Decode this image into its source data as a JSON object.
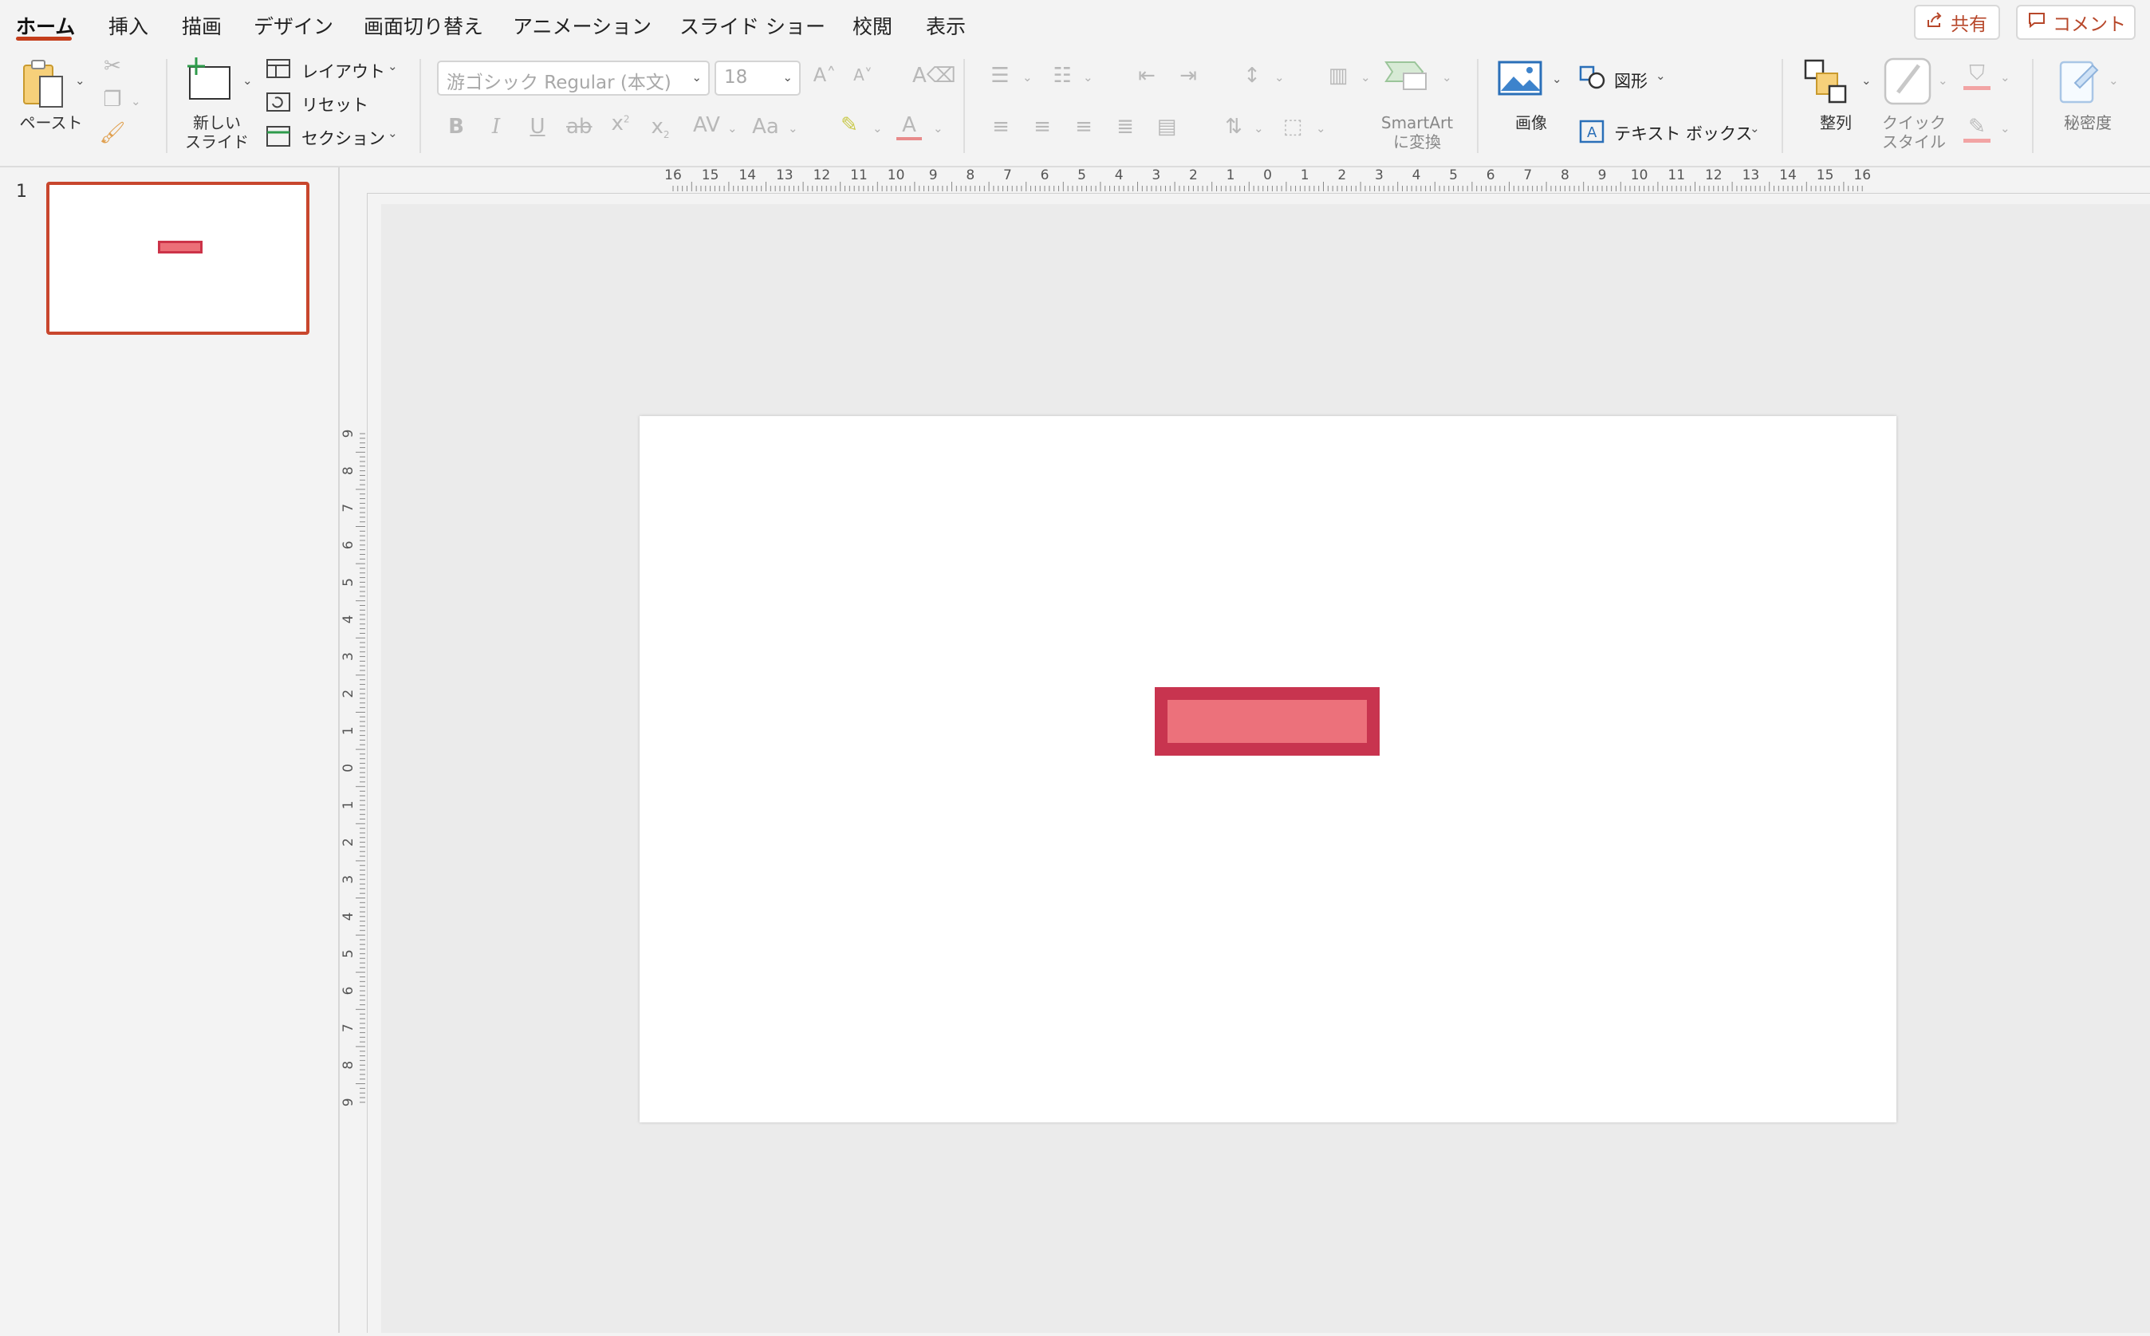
{
  "menu": {
    "tabs": [
      {
        "label": "ホーム",
        "active": true
      },
      {
        "label": "挿入"
      },
      {
        "label": "描画"
      },
      {
        "label": "デザイン"
      },
      {
        "label": "画面切り替え"
      },
      {
        "label": "アニメーション"
      },
      {
        "label": "スライド ショー"
      },
      {
        "label": "校閲"
      },
      {
        "label": "表示"
      }
    ],
    "share_label": "共有",
    "comment_label": "コメント"
  },
  "ribbon": {
    "paste_label": "ペースト",
    "new_slide_label_1": "新しい",
    "new_slide_label_2": "スライド",
    "layout_label": "レイアウト",
    "reset_label": "リセット",
    "section_label": "セクション",
    "font_name": "游ゴシック Regular (本文)",
    "font_size": "18",
    "smartart_label_1": "SmartArt",
    "smartart_label_2": "に変換",
    "image_label": "画像",
    "shapes_label": "図形",
    "textbox_label": "テキスト ボックス",
    "arrange_label": "整列",
    "quick_style_label_1": "クイック",
    "quick_style_label_2": "スタイル",
    "sensitivity_label": "秘密度",
    "format_glyphs": {
      "bold": "B",
      "italic": "I",
      "underline": "U",
      "strike": "ab",
      "superscript": "x",
      "subscript": "x",
      "spacing": "AV",
      "case": "Aa",
      "font_color": "A"
    }
  },
  "slides_panel": {
    "slide_number": "1"
  },
  "ruler": {
    "horizontal": [
      "16",
      "15",
      "14",
      "13",
      "12",
      "11",
      "10",
      "9",
      "8",
      "7",
      "6",
      "5",
      "4",
      "3",
      "2",
      "1",
      "0",
      "1",
      "2",
      "3",
      "4",
      "5",
      "6",
      "7",
      "8",
      "9",
      "10",
      "11",
      "12",
      "13",
      "14",
      "15",
      "16"
    ],
    "vertical": [
      "9",
      "8",
      "7",
      "6",
      "5",
      "4",
      "3",
      "2",
      "1",
      "0",
      "1",
      "2",
      "3",
      "4",
      "5",
      "6",
      "7",
      "8",
      "9"
    ]
  },
  "colors": {
    "accent": "#c43e1c",
    "shape_fill": "#ec717b",
    "shape_border": "#c8344f"
  }
}
